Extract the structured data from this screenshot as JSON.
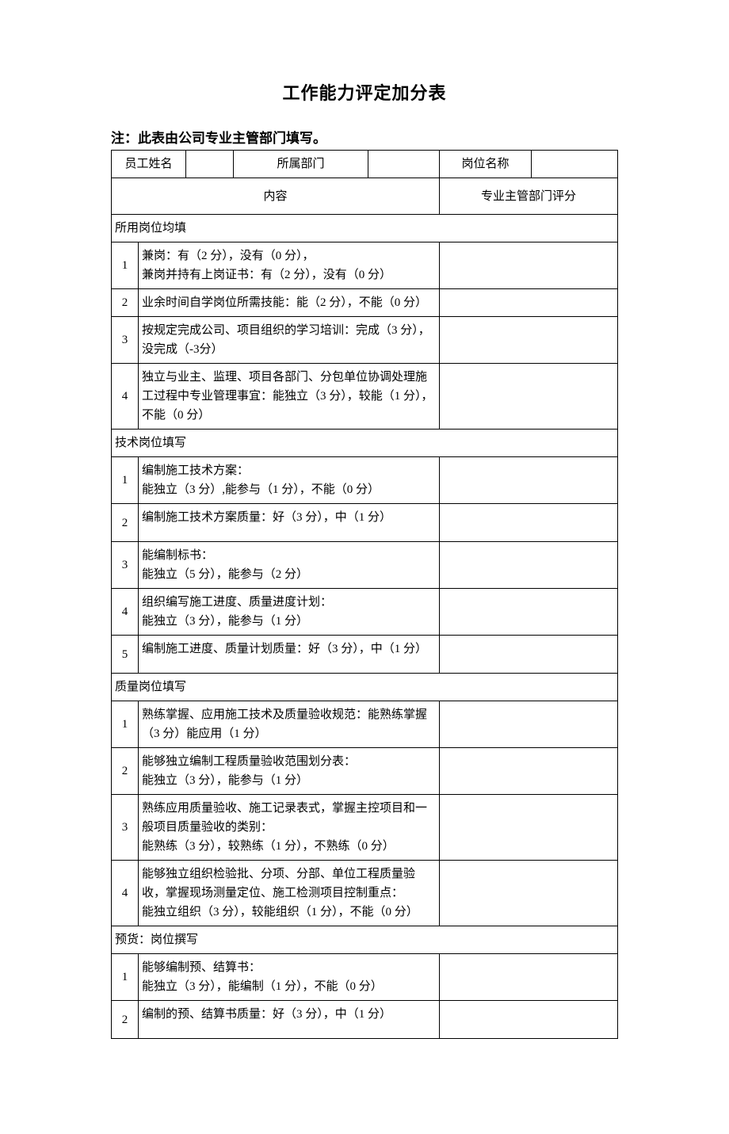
{
  "title": "工作能力评定加分表",
  "note": "注：此表由公司专业主管部门填写。",
  "header": {
    "name_label": "员工姓名",
    "dept_label": "所属部门",
    "post_label": "岗位名称",
    "content_label": "内容",
    "score_label": "专业主管部门评分"
  },
  "sections": [
    {
      "header": "所用岗位均填",
      "rows": [
        {
          "n": "1",
          "text": "兼岗：有（2 分），没有（0 分），\n兼岗并持有上岗证书：有（2 分），没有（0 分）"
        },
        {
          "n": "2",
          "text": "业余时间自学岗位所需技能：能（2 分），不能（0 分）"
        },
        {
          "n": "3",
          "text": "按规定完成公司、项目组织的学习培训：完成（3 分），没完成（-3分）"
        },
        {
          "n": "4",
          "text": "独立与业主、监理、项目各部门、分包单位协调处理施工过程中专业管理事宜：能独立（3 分），较能（1 分），不能（0 分）"
        }
      ]
    },
    {
      "header": "技术岗位填写",
      "rows": [
        {
          "n": "1",
          "text": "编制施工技术方案：\n能独立（3 分）,能参与（1 分），不能（0 分）"
        },
        {
          "n": "2",
          "text": "编制施工技术方案质量：好（3 分），中（1 分）",
          "tall": true
        },
        {
          "n": "3",
          "text": "能编制标书：\n能独立（5 分），能参与（2 分）"
        },
        {
          "n": "4",
          "text": "组织编写施工进度、质量进度计划：\n能独立（3 分），能参与（1 分）"
        },
        {
          "n": "5",
          "text": "编制施工进度、质量计划质量：好（3 分），中（1 分）",
          "tall": true
        }
      ]
    },
    {
      "header": "质量岗位填写",
      "rows": [
        {
          "n": "1",
          "text": "熟练掌握、应用施工技术及质量验收规范：能熟练掌握（3 分）能应用（1 分）"
        },
        {
          "n": "2",
          "text": "能够独立编制工程质量验收范围划分表：\n能独立（3 分），能参与（1 分）"
        },
        {
          "n": "3",
          "text": "熟练应用质量验收、施工记录表式，掌握主控项目和一般项目质量验收的类别：\n能熟练（3 分），较熟练（1 分），不熟练（0 分）"
        },
        {
          "n": "4",
          "text": "能够独立组织检验批、分项、分部、单位工程质量验收，掌握现场测量定位、施工检测项目控制重点：\n能独立组织（3 分），较能组织（1 分），不能（0 分）"
        }
      ]
    },
    {
      "header": "预货：岗位撰写",
      "rows": [
        {
          "n": "1",
          "text": "能够编制预、结算书：\n能独立（3 分），能编制（1 分），不能（0 分）"
        },
        {
          "n": "2",
          "text": "编制的预、结算书质量：好（3 分），中（1 分）",
          "tall": true
        }
      ]
    }
  ]
}
